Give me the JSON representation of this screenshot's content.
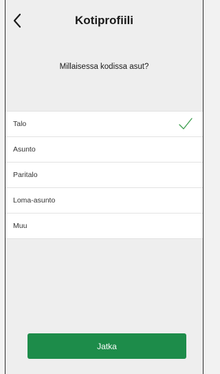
{
  "header": {
    "back_icon": "chevron-left-icon",
    "title": "Kotiprofiili"
  },
  "question": "Millaisessa kodissa asut?",
  "options": [
    {
      "label": "Talo",
      "selected": true
    },
    {
      "label": "Asunto",
      "selected": false
    },
    {
      "label": "Paritalo",
      "selected": false
    },
    {
      "label": "Loma-asunto",
      "selected": false
    },
    {
      "label": "Muu",
      "selected": false
    }
  ],
  "selected_icon": "checkmark-icon",
  "continue_label": "Jatka",
  "colors": {
    "accent": "#1d8c4a",
    "check": "#3a9d4c",
    "background": "#eeeeee",
    "list_background": "#ffffff"
  }
}
